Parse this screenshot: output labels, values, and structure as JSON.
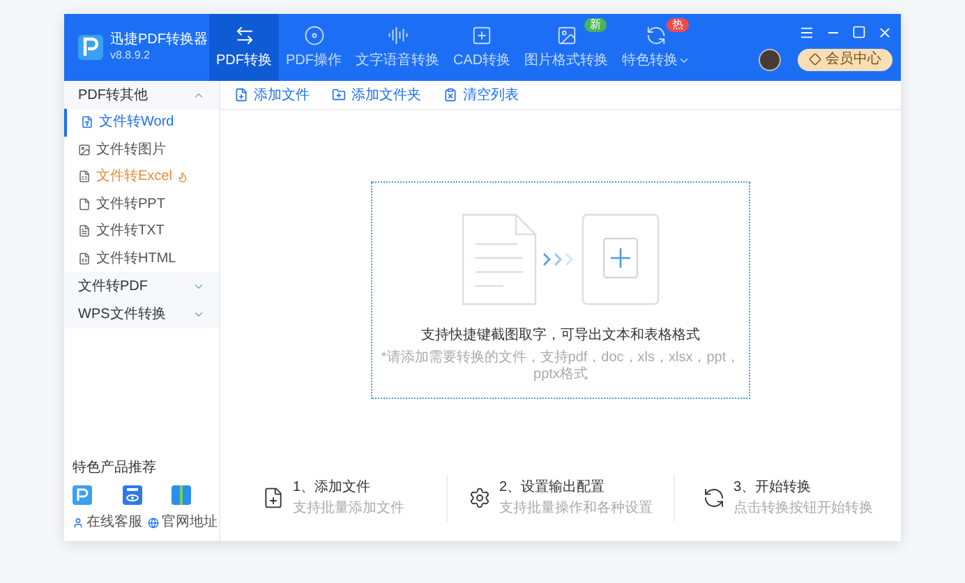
{
  "app": {
    "name": "迅捷PDF转换器",
    "version": "v8.8.9.2"
  },
  "nav_tabs": [
    {
      "label": "PDF转换",
      "selected": true
    },
    {
      "label": "PDF操作",
      "selected": false
    },
    {
      "label": "文字语音转换",
      "selected": false
    },
    {
      "label": "CAD转换",
      "selected": false
    },
    {
      "label": "图片格式转换",
      "selected": false,
      "badge": {
        "text": "新",
        "color": "#4cb35a"
      }
    },
    {
      "label": "特色转换",
      "selected": false,
      "dropdown": true,
      "badge": {
        "text": "热",
        "color": "#f2484d"
      }
    }
  ],
  "member_button": "会员中心",
  "sidebar": {
    "groups": [
      {
        "label": "PDF转其他",
        "expanded": true,
        "children": [
          {
            "label": "文件转Word",
            "selected": true,
            "hot": false
          },
          {
            "label": "文件转图片",
            "selected": false,
            "hot": false
          },
          {
            "label": "文件转Excel",
            "selected": false,
            "hot": true
          },
          {
            "label": "文件转PPT",
            "selected": false,
            "hot": false
          },
          {
            "label": "文件转TXT",
            "selected": false,
            "hot": false
          },
          {
            "label": "文件转HTML",
            "selected": false,
            "hot": false
          }
        ]
      },
      {
        "label": "文件转PDF",
        "expanded": false
      },
      {
        "label": "WPS文件转换",
        "expanded": false
      }
    ],
    "footer": {
      "heading": "特色产品推荐",
      "links": [
        "在线客服",
        "官网地址"
      ]
    }
  },
  "toolbar": [
    "添加文件",
    "添加文件夹",
    "清空列表"
  ],
  "dropzone": {
    "hint": "支持快捷键截图取字，可导出文本和表格格式",
    "note": "*请添加需要转换的文件，支持pdf，doc，xls，xlsx，ppt，pptx格式"
  },
  "steps": [
    {
      "title": "1、添加文件",
      "subtitle": "支持批量添加文件"
    },
    {
      "title": "2、设置输出配置",
      "subtitle": "支持批量操作和各种设置"
    },
    {
      "title": "3、开始转换",
      "subtitle": "点击转换按钮开始转换"
    }
  ]
}
